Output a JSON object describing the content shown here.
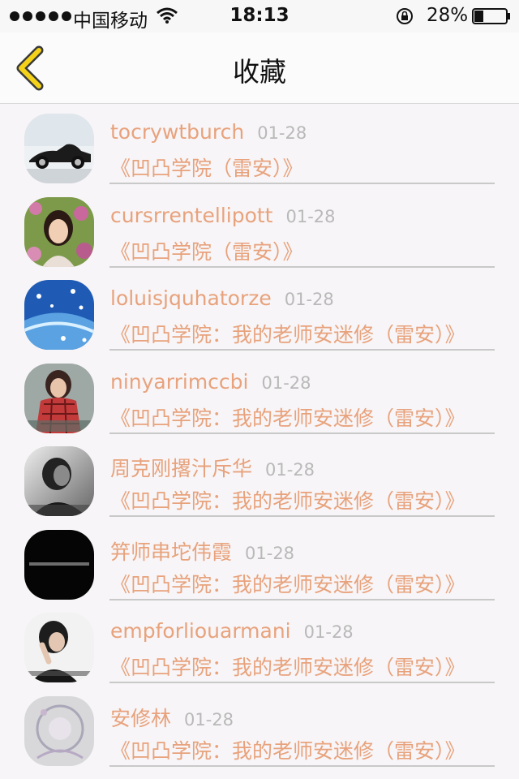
{
  "status_bar": {
    "carrier": "中国移动",
    "time": "18:13",
    "battery_percent": "28%",
    "battery_level": 0.28
  },
  "nav": {
    "title": "收藏",
    "back_icon": "chevron-left-icon"
  },
  "colors": {
    "accent": "#e8a27c",
    "back_chevron": "#f5d21a",
    "date": "#b9b9b9"
  },
  "favorites": [
    {
      "user": "tocrywtburch",
      "date": "01-28",
      "title": "《凹凸学院（雷安）》",
      "avatar": "car"
    },
    {
      "user": "cursrrentellipott",
      "date": "01-28",
      "title": "《凹凸学院（雷安）》",
      "avatar": "girl-flowers"
    },
    {
      "user": "loluisjquhatorze",
      "date": "01-28",
      "title": "《凹凸学院：我的老师安迷修（雷安）》",
      "avatar": "blue-snowflakes"
    },
    {
      "user": "ninyarrimccbi",
      "date": "01-28",
      "title": "《凹凸学院：我的老师安迷修（雷安）》",
      "avatar": "red-plaid-girl"
    },
    {
      "user": "周克刚撂汁斥华",
      "date": "01-28",
      "title": "《凹凸学院：我的老师安迷修（雷安）》",
      "avatar": "bw-portrait"
    },
    {
      "user": "笄师串坨伟霞",
      "date": "01-28",
      "title": "《凹凸学院：我的老师安迷修（雷安）》",
      "avatar": "black-text"
    },
    {
      "user": "empforliouarmani",
      "date": "01-28",
      "title": "《凹凸学院：我的老师安迷修（雷安）》",
      "avatar": "boy-white"
    },
    {
      "user": "安修林",
      "date": "01-28",
      "title": "《凹凸学院：我的老师安迷修（雷安）》",
      "avatar": "gray-sketch"
    }
  ]
}
